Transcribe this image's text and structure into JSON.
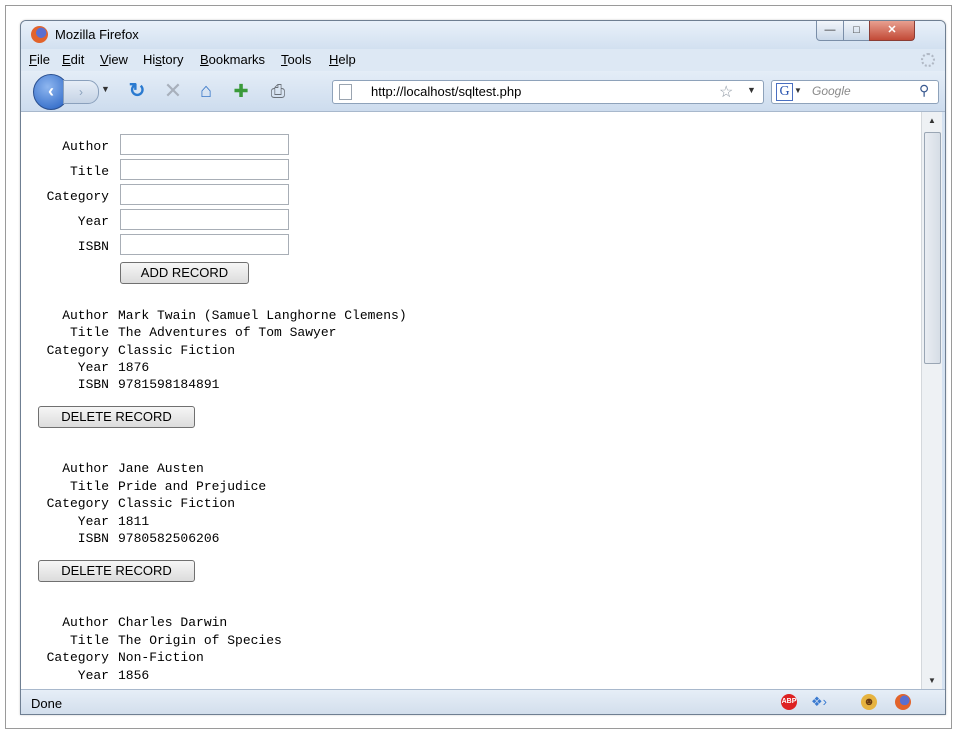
{
  "window": {
    "title": "Mozilla Firefox"
  },
  "menu": [
    {
      "accel": "F",
      "rest": "ile"
    },
    {
      "accel": "E",
      "rest": "dit"
    },
    {
      "accel": "V",
      "rest": "iew"
    },
    {
      "pre": "Hi",
      "accel": "s",
      "rest": "tory"
    },
    {
      "accel": "B",
      "rest": "ookmarks"
    },
    {
      "accel": "T",
      "rest": "ools"
    },
    {
      "accel": "H",
      "rest": "elp"
    }
  ],
  "address": {
    "url": "http://localhost/sqltest.php"
  },
  "search": {
    "engine_letter": "G",
    "placeholder": "Google"
  },
  "form": {
    "labels": [
      "Author",
      "Title",
      "Category",
      "Year",
      "ISBN"
    ],
    "values": [
      "",
      "",
      "",
      "",
      ""
    ],
    "submit_label": "ADD RECORD"
  },
  "records": [
    {
      "fields": [
        {
          "label": "Author",
          "value": "Mark Twain (Samuel Langhorne Clemens)"
        },
        {
          "label": "Title",
          "value": "The Adventures of Tom Sawyer"
        },
        {
          "label": "Category",
          "value": "Classic Fiction"
        },
        {
          "label": "Year",
          "value": "1876"
        },
        {
          "label": "ISBN",
          "value": "9781598184891"
        }
      ],
      "delete_label": "DELETE RECORD"
    },
    {
      "fields": [
        {
          "label": "Author",
          "value": "Jane Austen"
        },
        {
          "label": "Title",
          "value": "Pride and Prejudice"
        },
        {
          "label": "Category",
          "value": "Classic Fiction"
        },
        {
          "label": "Year",
          "value": "1811"
        },
        {
          "label": "ISBN",
          "value": "9780582506206"
        }
      ],
      "delete_label": "DELETE RECORD"
    },
    {
      "fields": [
        {
          "label": "Author",
          "value": "Charles Darwin"
        },
        {
          "label": "Title",
          "value": "The Origin of Species"
        },
        {
          "label": "Category",
          "value": "Non-Fiction"
        },
        {
          "label": "Year",
          "value": "1856"
        }
      ],
      "delete_label": ""
    }
  ],
  "status": {
    "text": "Done"
  },
  "icons": [
    "firefox-logo-icon",
    "back-arrow-icon",
    "forward-arrow-icon",
    "reload-icon",
    "stop-icon",
    "home-icon",
    "add-bookmark-icon",
    "print-icon",
    "page-icon",
    "star-icon",
    "google-icon",
    "search-icon",
    "adblock-icon",
    "addon-icon",
    "greasemonkey-icon",
    "firefox-status-icon"
  ]
}
